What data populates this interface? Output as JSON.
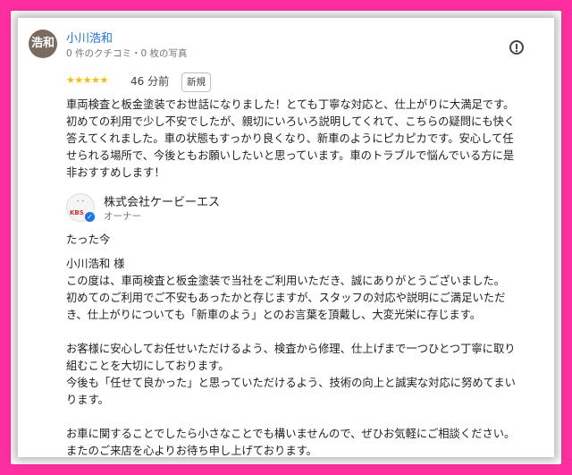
{
  "review": {
    "avatar_text": "浩和",
    "reviewer_name": "小川浩和",
    "reviewer_meta": "0 件のクチコミ・0 枚の写真",
    "stars": "★★★★★",
    "rating": 5,
    "time": "46 分前",
    "badge": "新規",
    "text": "車両検査と板金塗装でお世話になりました！とても丁寧な対応と、仕上がりに大満足です。\n初めての利用で少し不安でしたが、親切にいろいろ説明してくれて、こちらの疑問にも快く\n答えてくれました。車の状態もすっかり良くなり、新車のようにピカピカです。安心して任\nせられる場所で、今後ともお願いしたいと思っています。車のトラブルで悩んでいる方に是\n非おすすめします！"
  },
  "owner_reply": {
    "logo_text": "KBS",
    "owner_name": "株式会社ケービーエス",
    "owner_role": "オーナー",
    "time": "たった今",
    "text": "小川浩和 様\nこの度は、車両検査と板金塗装で当社をご利用いただき、誠にありがとうございました。\n初めてのご利用でご不安もあったかと存じますが、スタッフの対応や説明にご満足いただ\nき、仕上がりについても「新車のよう」とのお言葉を頂戴し、大変光栄に存じます。\n\nお客様に安心してお任せいただけるよう、検査から修理、仕上げまで一つひとつ丁寧に取り\n組むことを大切にしております。\n今後も「任せて良かった」と思っていただけるよう、技術の向上と誠実な対応に努めてまい\nります。\n\nお車に関することでしたら小さなことでも構いませんので、ぜひお気軽にご相談ください。\nまたのご来店を心よりお待ち申し上げております。"
  },
  "colors": {
    "frame": "#ff2ea0",
    "link": "#1a73e8",
    "star": "#fbbc04"
  }
}
